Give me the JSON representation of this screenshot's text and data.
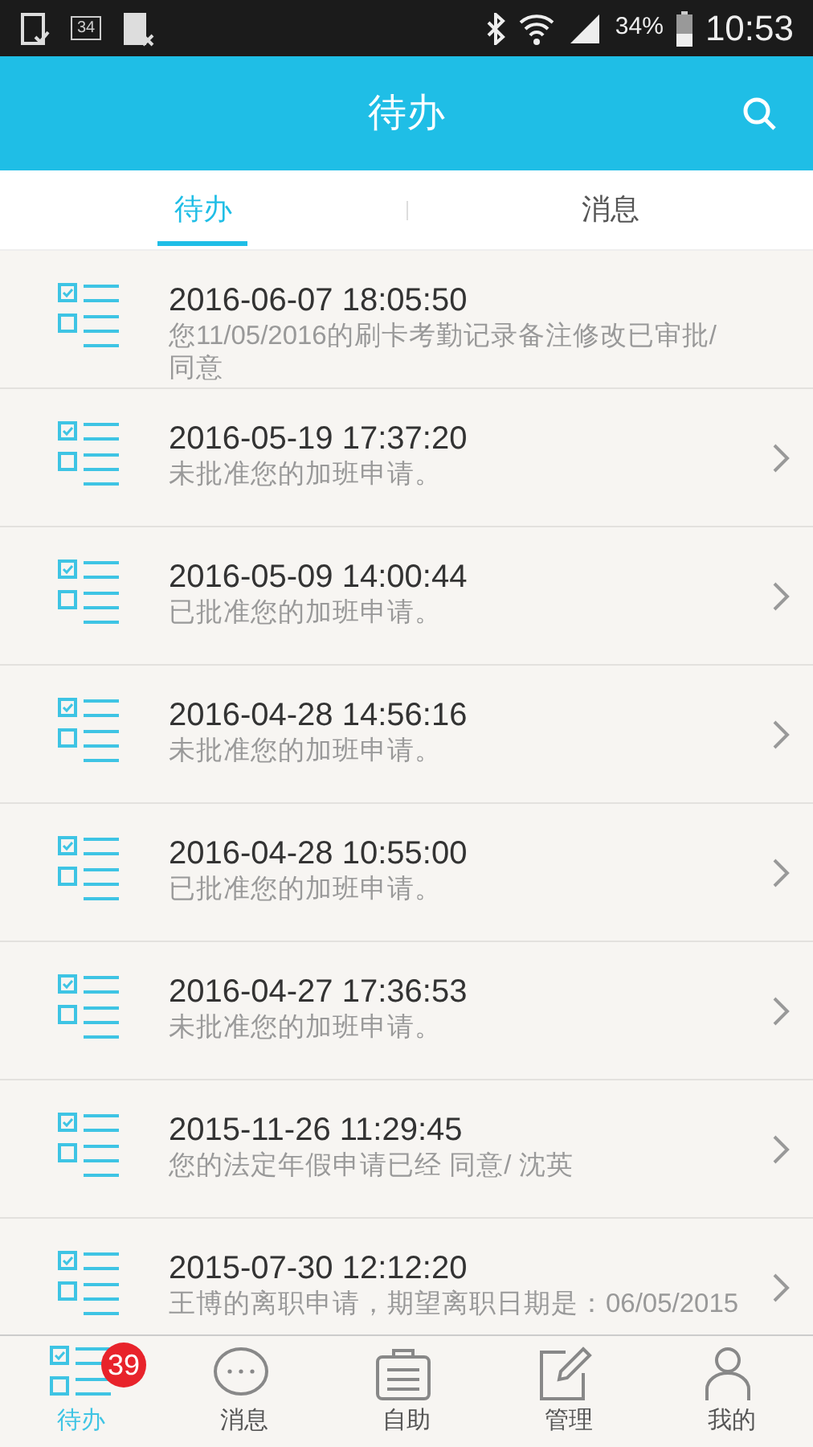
{
  "status_bar": {
    "battery_percent": "34%",
    "time": "10:53",
    "notification_badge": "34"
  },
  "header": {
    "title": "待办"
  },
  "tabs": [
    {
      "label": "待办",
      "selected": true
    },
    {
      "label": "消息",
      "selected": false
    }
  ],
  "items": [
    {
      "time": "2016-06-07 18:05:50",
      "text": "您11/05/2016的刷卡考勤记录备注修改已审批/同意",
      "chevron": false
    },
    {
      "time": "2016-05-19 17:37:20",
      "text": "未批准您的加班申请。",
      "chevron": true
    },
    {
      "time": "2016-05-09 14:00:44",
      "text": "已批准您的加班申请。",
      "chevron": true
    },
    {
      "time": "2016-04-28 14:56:16",
      "text": "未批准您的加班申请。",
      "chevron": true
    },
    {
      "time": "2016-04-28 10:55:00",
      "text": "已批准您的加班申请。",
      "chevron": true
    },
    {
      "time": "2016-04-27 17:36:53",
      "text": "未批准您的加班申请。",
      "chevron": true
    },
    {
      "time": "2015-11-26 11:29:45",
      "text": "您的法定年假申请已经 同意/ 沈英",
      "chevron": true
    },
    {
      "time": "2015-07-30 12:12:20",
      "text": "王博的离职申请，期望离职日期是：06/05/2015",
      "chevron": true
    }
  ],
  "bottom_nav": [
    {
      "label": "待办",
      "kind": "todo",
      "selected": true,
      "badge": "39"
    },
    {
      "label": "消息",
      "kind": "chat",
      "selected": false
    },
    {
      "label": "自助",
      "kind": "case",
      "selected": false
    },
    {
      "label": "管理",
      "kind": "edit",
      "selected": false
    },
    {
      "label": "我的",
      "kind": "person",
      "selected": false
    }
  ]
}
